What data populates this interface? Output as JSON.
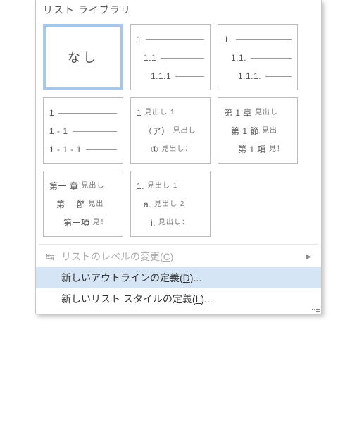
{
  "header": "リスト ライブラリ",
  "tiles": [
    {
      "type": "none",
      "label": "なし",
      "selected": true
    },
    {
      "type": "levels",
      "lines": [
        {
          "lbl": "1",
          "indent": 0
        },
        {
          "lbl": "1.1",
          "indent": 1
        },
        {
          "lbl": "1.1.1",
          "indent": 2
        }
      ]
    },
    {
      "type": "levels",
      "lines": [
        {
          "lbl": "1.",
          "indent": 0
        },
        {
          "lbl": "1.1.",
          "indent": 1
        },
        {
          "lbl": "1.1.1.",
          "indent": 2
        }
      ]
    },
    {
      "type": "levels",
      "lines": [
        {
          "lbl": "1",
          "indent": 0
        },
        {
          "lbl": "1 - 1",
          "indent": 0
        },
        {
          "lbl": "1 - 1 - 1",
          "indent": 0
        }
      ]
    },
    {
      "type": "heading",
      "lines": [
        {
          "lbl": "1",
          "sub": "見出し 1",
          "indent": 0
        },
        {
          "lbl": "（ア）",
          "sub": "見出し",
          "indent": 1
        },
        {
          "lbl": "①",
          "sub": "見出し：",
          "indent": 2
        }
      ]
    },
    {
      "type": "heading",
      "lines": [
        {
          "lbl": "第 1 章",
          "sub": "見出し",
          "indent": 0
        },
        {
          "lbl": "第 1 節",
          "sub": "見出",
          "indent": 1
        },
        {
          "lbl": "第 1 項",
          "sub": "見！",
          "indent": 2
        }
      ]
    },
    {
      "type": "heading",
      "lines": [
        {
          "lbl": "第一 章",
          "sub": "見出し",
          "indent": 0
        },
        {
          "lbl": "第一 節",
          "sub": "見出",
          "indent": 1
        },
        {
          "lbl": "第一項",
          "sub": "見！",
          "indent": 2
        }
      ]
    },
    {
      "type": "heading",
      "lines": [
        {
          "lbl": "1.",
          "sub": "見出し 1",
          "indent": 0
        },
        {
          "lbl": "a.",
          "sub": "見出し 2",
          "indent": 1
        },
        {
          "lbl": "i.",
          "sub": "見出し：",
          "indent": 2
        }
      ]
    }
  ],
  "menu": {
    "change_level": {
      "label": "リストのレベルの変更",
      "accel": "C",
      "disabled": true
    },
    "define_outline": {
      "label": "新しいアウトラインの定義",
      "accel": "D",
      "suffix": "...",
      "hover": true
    },
    "define_list_style": {
      "label": "新しいリスト スタイルの定義",
      "accel": "L",
      "suffix": "..."
    }
  }
}
